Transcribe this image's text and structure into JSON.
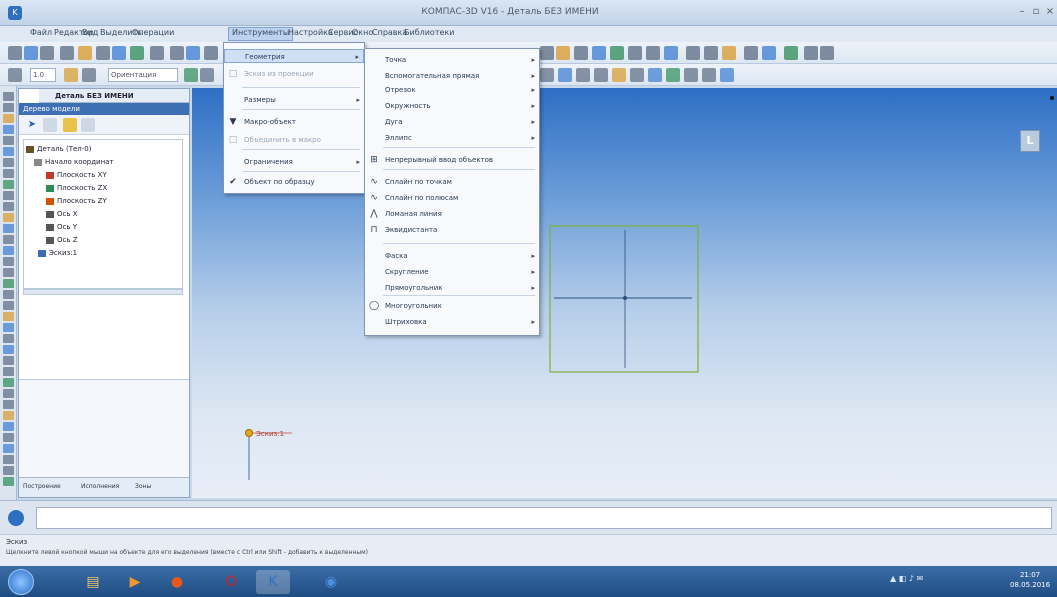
{
  "window": {
    "title": "КОМПАС-3D V16 - Деталь БЕЗ ИМЕНИ"
  },
  "menubar": {
    "items": [
      "Файл",
      "Редактор",
      "Вид",
      "Выделить",
      "Операции",
      "Инструменты",
      "Настройка",
      "Сервис",
      "Окно",
      "Справка",
      "Библиотеки"
    ],
    "active": "Инструменты"
  },
  "toolbar": {
    "field_value": "Ориентация",
    "zoom_value": "1.0"
  },
  "tree": {
    "tab": "Деталь БЕЗ ИМЕНИ",
    "header": "Дерево модели",
    "items": [
      {
        "label": "Деталь (Тел-0)",
        "icon_color": "#6b4f2a"
      },
      {
        "label": "Начало координат",
        "icon_color": "#888888"
      },
      {
        "label": "Плоскость XY",
        "icon_color": "#c0392b"
      },
      {
        "label": "Плоскость ZX",
        "icon_color": "#2e8b57"
      },
      {
        "label": "Плоскость ZY",
        "icon_color": "#d35400"
      },
      {
        "label": "Ось X",
        "icon_color": "#555555"
      },
      {
        "label": "Ось Y",
        "icon_color": "#555555"
      },
      {
        "label": "Ось Z",
        "icon_color": "#555555"
      },
      {
        "label": "Эскиз:1",
        "icon_color": "#3b6db3"
      }
    ],
    "bottom_tabs": [
      "Построение",
      "Исполнения",
      "Зоны"
    ]
  },
  "menu1": {
    "items": [
      {
        "label": "Геометрия",
        "has_sub": true,
        "highlighted": true,
        "disabled": false,
        "icon": ""
      },
      {
        "label": "Эскиз из проекции",
        "has_sub": false,
        "highlighted": false,
        "disabled": true,
        "icon": "□"
      },
      {
        "label": "Размеры",
        "has_sub": true,
        "highlighted": false,
        "disabled": false,
        "icon": ""
      },
      {
        "label": "Макро-объект",
        "has_sub": false,
        "highlighted": false,
        "disabled": false,
        "icon": "▼"
      },
      {
        "label": "Объединить в макро",
        "has_sub": false,
        "highlighted": false,
        "disabled": true,
        "icon": "□"
      },
      {
        "label": "Ограничения",
        "has_sub": true,
        "highlighted": false,
        "disabled": false,
        "icon": ""
      },
      {
        "label": "Объект по образцу",
        "has_sub": false,
        "highlighted": false,
        "disabled": false,
        "icon": "✔"
      }
    ]
  },
  "menu2": {
    "items": [
      {
        "label": "Точка",
        "has_sub": true,
        "icon": ""
      },
      {
        "label": "Вспомогательная прямая",
        "has_sub": true,
        "icon": ""
      },
      {
        "label": "Отрезок",
        "has_sub": true,
        "icon": ""
      },
      {
        "label": "Окружность",
        "has_sub": true,
        "icon": ""
      },
      {
        "label": "Дуга",
        "has_sub": true,
        "icon": ""
      },
      {
        "label": "Эллипс",
        "has_sub": true,
        "icon": ""
      },
      {
        "label": "Непрерывный ввод объектов",
        "has_sub": false,
        "icon": "⊞"
      },
      {
        "label": "Сплайн по точкам",
        "has_sub": false,
        "icon": "∿"
      },
      {
        "label": "Сплайн по полюсам",
        "has_sub": false,
        "icon": "∿"
      },
      {
        "label": "Ломаная линия",
        "has_sub": false,
        "icon": "⋀"
      },
      {
        "label": "Эквидистанта",
        "has_sub": false,
        "icon": "⊓"
      },
      {
        "label": "Фаска",
        "has_sub": true,
        "icon": ""
      },
      {
        "label": "Скругление",
        "has_sub": true,
        "icon": ""
      },
      {
        "label": "Прямоугольник",
        "has_sub": true,
        "icon": ""
      },
      {
        "label": "Многоугольник",
        "has_sub": false,
        "icon": "◯"
      },
      {
        "label": "Штриховка",
        "has_sub": true,
        "icon": ""
      }
    ]
  },
  "viewport": {
    "axis_label": "Эскиз:1",
    "view_cube_label": "L"
  },
  "statusbar": {
    "label": "Эскиз",
    "text": "Щелкните левой кнопкой мыши на объекте для его выделения (вместе с Ctrl или Shift - добавить к выделенным)"
  },
  "taskbar": {
    "apps": [
      {
        "name": "explorer",
        "glyph": "▤",
        "color": "#e8c66a"
      },
      {
        "name": "media",
        "glyph": "▶",
        "color": "#f0962b"
      },
      {
        "name": "firefox",
        "glyph": "●",
        "color": "#e8581c"
      },
      {
        "name": "opera",
        "glyph": "O",
        "color": "#d3212a"
      },
      {
        "name": "kompas",
        "glyph": "K",
        "color": "#2f6fbf"
      },
      {
        "name": "chrome",
        "glyph": "◉",
        "color": "#4a90e2"
      }
    ],
    "tray_icons": "▲ ◧ ♪ ✉",
    "clock": {
      "time": "21:07",
      "date": "08.05.2016"
    }
  },
  "colors": {
    "accent": "#3d6fb5",
    "sketch_frame": "#7fae3a",
    "axis": "#2c4f7a"
  }
}
